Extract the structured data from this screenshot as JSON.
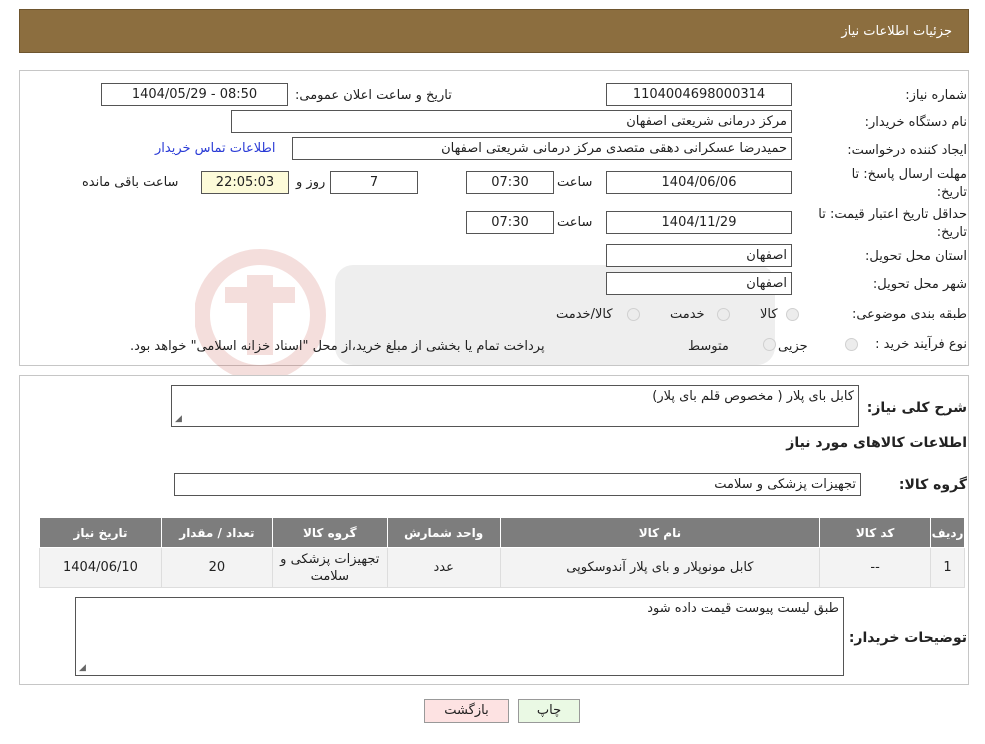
{
  "header": {
    "title": "جزئیات اطلاعات نیاز"
  },
  "fields": {
    "need_number_label": "شماره نیاز:",
    "need_number": "1104004698000314",
    "announce_label": "تاریخ و ساعت اعلان عمومی:",
    "announce_value": "1404/05/29 - 08:50",
    "buyer_org_label": "نام دستگاه خریدار:",
    "buyer_org": "مرکز درمانی شریعتی اصفهان",
    "requester_label": "ایجاد کننده درخواست:",
    "requester": "حمیدرضا عسکرانی دهقی متصدی مرکز درمانی شریعتی اصفهان",
    "contact_link": "اطلاعات تماس خریدار",
    "deadline_label_1": "مهلت ارسال پاسخ: تا",
    "deadline_label_2": "تاریخ:",
    "deadline_date": "1404/06/06",
    "time_label": "ساعت",
    "deadline_time": "07:30",
    "days_value": "7",
    "days_label": "روز و",
    "remaining_time": "22:05:03",
    "remaining_label": "ساعت باقی مانده",
    "validity_label_1": "حداقل تاریخ اعتبار قیمت: تا",
    "validity_label_2": "تاریخ:",
    "validity_date": "1404/11/29",
    "validity_time": "07:30",
    "province_label": "استان محل تحویل:",
    "province": "اصفهان",
    "city_label": "شهر محل تحویل:",
    "city": "اصفهان",
    "category_label": "طبقه بندی موضوعی:",
    "category_options": [
      "کالا",
      "خدمت",
      "کالا/خدمت"
    ],
    "process_label": "نوع فرآیند خرید :",
    "process_options": [
      "جزیی",
      "متوسط"
    ],
    "process_note": "پرداخت تمام یا بخشی از مبلغ خرید،از محل \"اسناد خزانه اسلامی\" خواهد بود."
  },
  "summary": {
    "desc_label": "شرح کلی نیاز:",
    "desc_value": "کابل بای پلار ( مخصوص قلم بای پلار)",
    "goods_info_title": "اطلاعات کالاهای مورد نیاز",
    "group_label": "گروه کالا:",
    "group_value": "تجهیزات پزشکی و سلامت"
  },
  "table": {
    "headers": [
      "ردیف",
      "کد کالا",
      "نام کالا",
      "واحد شمارش",
      "گروه کالا",
      "تعداد / مقدار",
      "تاریخ نیاز"
    ],
    "rows": [
      [
        "1",
        "--",
        "کابل مونوپلار و بای پلار آندوسکوپی",
        "عدد",
        "تجهیزات پزشکی و سلامت",
        "20",
        "1404/06/10"
      ]
    ]
  },
  "buyer_notes": {
    "label": "توضیحات خریدار:",
    "value": "طبق لیست پیوست قیمت داده شود"
  },
  "buttons": {
    "print": "چاپ",
    "back": "بازگشت"
  },
  "colors": {
    "header": "#8c6e3f",
    "print_bg": "#eaf9e4",
    "back_bg": "#fde2e2",
    "table_header": "#7d7d7d"
  }
}
